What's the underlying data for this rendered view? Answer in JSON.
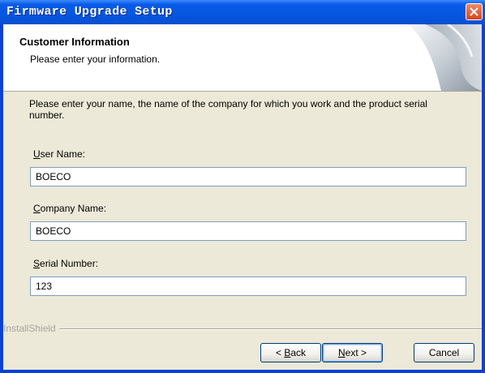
{
  "window": {
    "title": "Firmware Upgrade Setup"
  },
  "header": {
    "title": "Customer Information",
    "subtitle": "Please enter your information."
  },
  "body": {
    "instructions": "Please enter your name, the name of the company for which you work and the product serial number."
  },
  "fields": {
    "user_name": {
      "label_accel": "U",
      "label_rest": "ser Name:",
      "value": "BOECO"
    },
    "company_name": {
      "label_accel": "C",
      "label_rest": "ompany Name:",
      "value": "BOECO"
    },
    "serial_number": {
      "label_accel": "S",
      "label_rest": "erial Number:",
      "value": "123"
    }
  },
  "footer": {
    "brand": "InstallShield"
  },
  "buttons": {
    "back_prefix": "< ",
    "back_accel": "B",
    "back_rest": "ack",
    "next_accel": "N",
    "next_rest": "ext >",
    "cancel": "Cancel"
  },
  "colors": {
    "titlebar": "#0556e0",
    "dialog_bg": "#ece9d8",
    "close_button": "#d4431d"
  }
}
